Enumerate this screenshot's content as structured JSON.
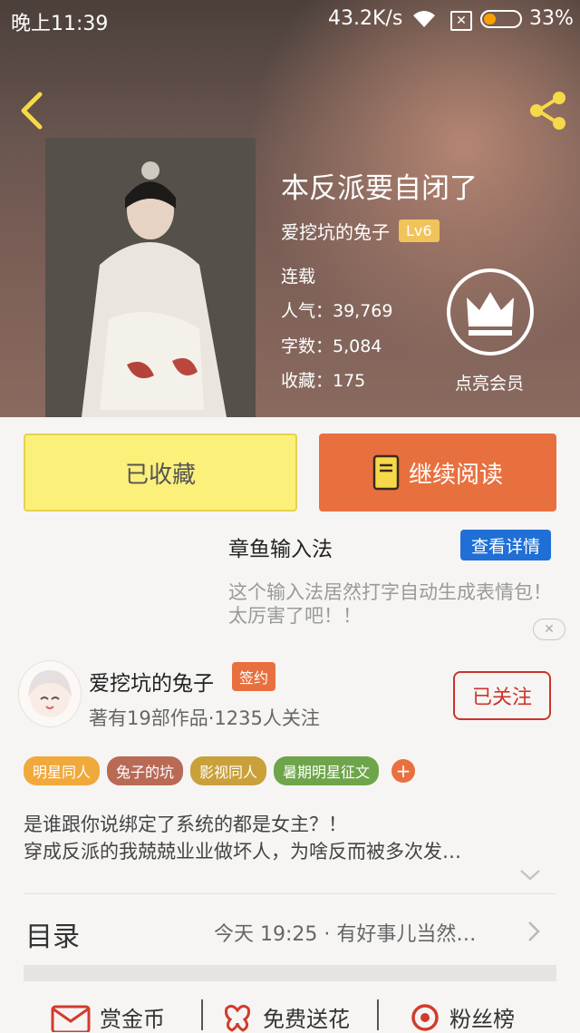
{
  "status_bar": {
    "time": "晚上11:39",
    "speed": "43.2K/s",
    "battery": "33%",
    "battery_level": 0.33
  },
  "book": {
    "title": "本反派要自闭了",
    "author": "爱挖坑的兔子",
    "level": "Lv6",
    "status": "连载",
    "popularity": "人气：39,769",
    "word_count": "字数：5,084",
    "favorites": "收藏：175"
  },
  "vip": {
    "label": "点亮会员"
  },
  "actions": {
    "collected_label": "已收藏",
    "continue_label": "继续阅读"
  },
  "ad": {
    "title": "章鱼输入法",
    "button": "查看详情",
    "text": "这个输入法居然打字自动生成表情包！太厉害了吧！！"
  },
  "author_card": {
    "name": "爱挖坑的兔子",
    "badge": "签约",
    "stats": "著有19部作品·1235人关注",
    "follow_label": "已关注"
  },
  "tags": [
    {
      "label": "明星同人",
      "color": "#f0a93a"
    },
    {
      "label": "兔子的坑",
      "color": "#b96a55"
    },
    {
      "label": "影视同人",
      "color": "#c9a03a"
    },
    {
      "label": "暑期明星征文",
      "color": "#6ea54a"
    }
  ],
  "description": {
    "line1": "是谁跟你说绑定了系统的都是女主？！",
    "line2": "穿成反派的我兢兢业业做坏人，为啥反而被多次发…"
  },
  "toc": {
    "label": "目录",
    "latest": "今天 19:25 · 有好事儿当然…"
  },
  "bottom_bar": {
    "reward": "赏金币",
    "flowers": "免费送花",
    "fans": "粉丝榜"
  },
  "colors": {
    "accent_orange": "#e8703f",
    "collected_yellow": "#fbf07a",
    "follow_red": "#c8352b",
    "ad_blue": "#1f6fd6"
  }
}
